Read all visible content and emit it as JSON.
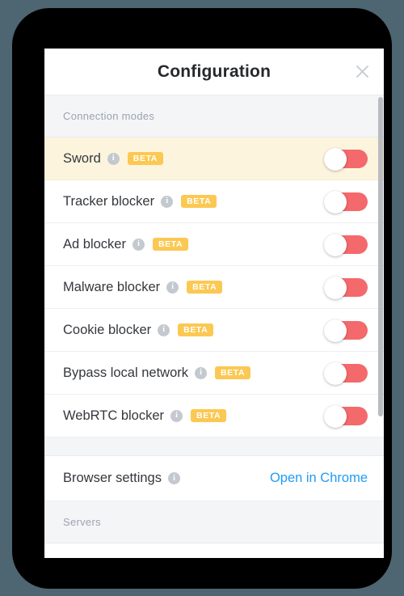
{
  "window": {
    "backdrop_color": "#4d6671",
    "frame_color": "#000000"
  },
  "header": {
    "title": "Configuration",
    "close_icon": "close-icon"
  },
  "colors": {
    "toggle_off_track": "#f4696b",
    "toggle_on_track": "#2196f3",
    "beta_badge_bg": "#fbc852",
    "link": "#1f9bf5",
    "highlight_row_bg": "#fdf4dd",
    "section_header_bg": "#f4f5f7"
  },
  "sections": [
    {
      "id": "connection-modes",
      "label": "Connection modes",
      "rows": [
        {
          "id": "sword",
          "label": "Sword",
          "info": "i",
          "badge": "BETA",
          "toggle": "off",
          "highlighted": true
        },
        {
          "id": "tracker-blocker",
          "label": "Tracker blocker",
          "info": "i",
          "badge": "BETA",
          "toggle": "off",
          "highlighted": false
        },
        {
          "id": "ad-blocker",
          "label": "Ad blocker",
          "info": "i",
          "badge": "BETA",
          "toggle": "off",
          "highlighted": false
        },
        {
          "id": "malware-blocker",
          "label": "Malware blocker",
          "info": "i",
          "badge": "BETA",
          "toggle": "off",
          "highlighted": false
        },
        {
          "id": "cookie-blocker",
          "label": "Cookie blocker",
          "info": "i",
          "badge": "BETA",
          "toggle": "off",
          "highlighted": false
        },
        {
          "id": "bypass-local-network",
          "label": "Bypass local network",
          "info": "i",
          "badge": "BETA",
          "toggle": "off",
          "highlighted": false
        },
        {
          "id": "webrtc-blocker",
          "label": "WebRTC blocker",
          "info": "i",
          "badge": "BETA",
          "toggle": "off",
          "highlighted": false
        }
      ]
    }
  ],
  "browser_settings": {
    "label": "Browser settings",
    "info": "i",
    "action_label": "Open in Chrome"
  },
  "servers_section": {
    "label": "Servers",
    "partial_row_toggle": "on"
  },
  "scrollbar": {
    "name": "vertical-scrollbar"
  }
}
